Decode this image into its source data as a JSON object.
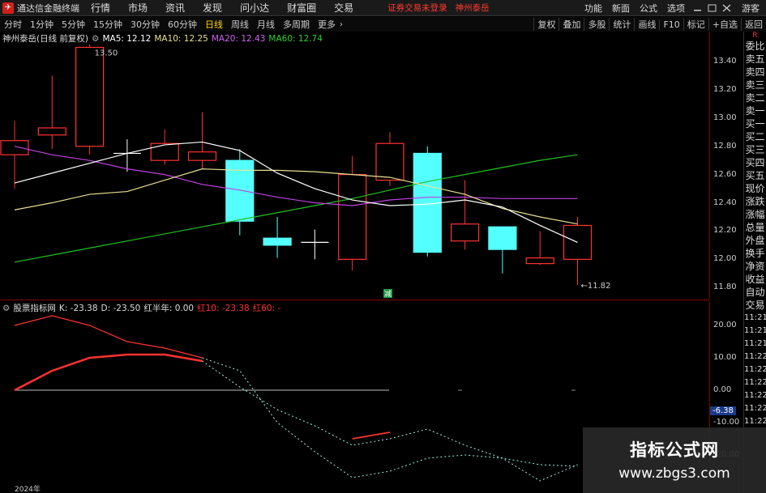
{
  "app": {
    "title": "通达信金融终端",
    "menu": [
      "行情",
      "市场",
      "资讯",
      "发现",
      "问小达",
      "财富圈",
      "交易"
    ],
    "login_warning": "证券交易未登录",
    "stock_tag": "神州泰岳",
    "right_menu": [
      "功能",
      "新面",
      "公式",
      "选项"
    ],
    "guest": "游客"
  },
  "period_bar": {
    "items": [
      "分时",
      "1分钟",
      "5分钟",
      "15分钟",
      "30分钟",
      "60分钟",
      "日线",
      "周线",
      "月线",
      "多周期",
      "更多"
    ],
    "active": "日线",
    "tools": [
      "复权",
      "叠加",
      "多股",
      "统计",
      "画线",
      "F10",
      "标记",
      "+自选",
      "返回"
    ]
  },
  "main_legend": {
    "stock": "神州泰岳(日线 前复权)",
    "ma5": "MA5: 12.12",
    "ma10": "MA10: 12.25",
    "ma20": "MA20: 12.43",
    "ma60": "MA60: 12.74",
    "high_label": "13.50",
    "low_label": "11.82",
    "marker": "减"
  },
  "sub_legend": {
    "name": "股票指标网",
    "k": "K: -23.38",
    "d": "D: -23.50",
    "hong": "红半年: 0.00",
    "hong10": "红10: -23.38",
    "hong60": "红60: -"
  },
  "main_axis": [
    "13.40",
    "13.20",
    "13.00",
    "12.80",
    "12.60",
    "12.40",
    "12.20",
    "12.00",
    "11.80"
  ],
  "sub_axis": [
    "20.00",
    "10.00",
    "0.00",
    "-10.00",
    "-20.00"
  ],
  "sub_current": "-6.38",
  "side_panel": [
    "委比",
    "卖五",
    "卖四",
    "卖三",
    "卖二",
    "卖一",
    "买一",
    "买二",
    "买三",
    "买四",
    "买五",
    "现价",
    "涨跌",
    "涨幅",
    "总量",
    "外盘",
    "换手",
    "净资",
    "收益",
    "自动",
    "交易"
  ],
  "side_times": [
    "11:21",
    "11:21",
    "11:21",
    "11:22",
    "11:22",
    "11:22",
    "11:22",
    "11:22",
    "11:22"
  ],
  "side_top": "R",
  "year": "2024年",
  "watermark": {
    "line1": "指标公式网",
    "line2": "www.zbgs3.com"
  },
  "colors": {
    "up": "#ff3232",
    "down": "#54ffff",
    "ma5": "#ffffff",
    "ma10": "#e8e090",
    "ma20": "#c040e0",
    "ma60": "#20c020",
    "axis": "#8b0000"
  },
  "chart_data": {
    "type": "candlestick",
    "y_range": [
      11.75,
      13.52
    ],
    "candles": [
      {
        "o": 12.74,
        "c": 12.84,
        "h": 12.98,
        "l": 12.5
      },
      {
        "o": 12.88,
        "c": 12.93,
        "h": 13.3,
        "l": 12.78
      },
      {
        "o": 12.8,
        "c": 13.5,
        "h": 13.52,
        "l": 12.74
      },
      {
        "o": 12.75,
        "c": 12.75,
        "h": 12.85,
        "l": 12.62
      },
      {
        "o": 12.7,
        "c": 12.82,
        "h": 12.92,
        "l": 12.67
      },
      {
        "o": 12.7,
        "c": 12.76,
        "h": 13.04,
        "l": 12.64
      },
      {
        "o": 12.7,
        "c": 12.27,
        "h": 12.78,
        "l": 12.17
      },
      {
        "o": 12.15,
        "c": 12.1,
        "h": 12.3,
        "l": 12.01
      },
      {
        "o": 12.12,
        "c": 12.12,
        "h": 12.21,
        "l": 12.0
      },
      {
        "o": 12.0,
        "c": 12.6,
        "h": 12.73,
        "l": 11.92
      },
      {
        "o": 12.56,
        "c": 12.82,
        "h": 12.9,
        "l": 12.52
      },
      {
        "o": 12.75,
        "c": 12.05,
        "h": 12.8,
        "l": 12.02
      },
      {
        "o": 12.13,
        "c": 12.25,
        "h": 12.56,
        "l": 12.07
      },
      {
        "o": 12.23,
        "c": 12.07,
        "h": 12.23,
        "l": 11.9
      },
      {
        "o": 11.97,
        "c": 12.01,
        "h": 12.2,
        "l": 11.96
      },
      {
        "o": 12.0,
        "c": 12.24,
        "h": 12.3,
        "l": 11.82
      }
    ],
    "ma5": [
      12.54,
      12.61,
      12.68,
      12.75,
      12.81,
      12.83,
      12.77,
      12.61,
      12.5,
      12.42,
      12.38,
      12.39,
      12.42,
      12.37,
      12.24,
      12.12
    ],
    "ma10": [
      12.35,
      12.4,
      12.46,
      12.48,
      12.56,
      12.64,
      12.63,
      12.63,
      12.62,
      12.6,
      12.58,
      12.52,
      12.46,
      12.36,
      12.3,
      12.25
    ],
    "ma20": [
      12.8,
      12.74,
      12.7,
      12.64,
      12.6,
      12.53,
      12.49,
      12.44,
      12.4,
      12.38,
      12.42,
      12.44,
      12.44,
      12.43,
      12.43,
      12.43
    ],
    "ma60": [
      11.98,
      12.03,
      12.08,
      12.13,
      12.18,
      12.23,
      12.28,
      12.33,
      12.38,
      12.43,
      12.49,
      12.55,
      12.6,
      12.65,
      12.7,
      12.74
    ],
    "sub_y_range": [
      -28,
      25
    ],
    "k_line": [
      20,
      23,
      20,
      15,
      13,
      10,
      6,
      -10,
      -19,
      -27,
      -25,
      -21,
      -20,
      -21,
      -28,
      -23
    ],
    "d_line": [
      0,
      6,
      10,
      11,
      11,
      9,
      1,
      -6,
      -11,
      -17,
      -15,
      -12,
      -17,
      -21,
      -23,
      -23.5
    ]
  }
}
